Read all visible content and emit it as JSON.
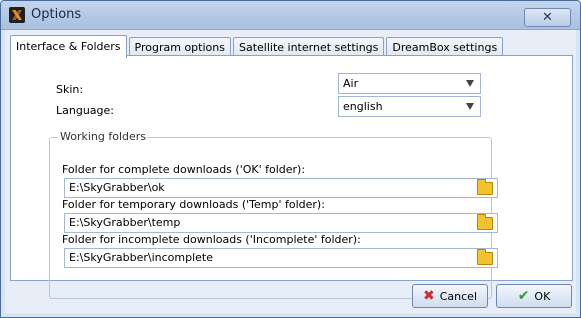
{
  "window": {
    "title": "Options",
    "close_label": "✕"
  },
  "tabs": [
    {
      "label": "Interface & Folders"
    },
    {
      "label": "Program options"
    },
    {
      "label": "Satellite internet settings"
    },
    {
      "label": "DreamBox settings"
    }
  ],
  "interface": {
    "skin_label": "Skin:",
    "skin_value": "Air",
    "language_label": "Language:",
    "language_value": "english"
  },
  "working_folders": {
    "title": "Working folders",
    "ok_label": "Folder for complete downloads ('OK' folder):",
    "ok_value": "E:\\SkyGrabber\\ok",
    "temp_label": "Folder for temporary downloads ('Temp' folder):",
    "temp_value": "E:\\SkyGrabber\\temp",
    "incomplete_label": "Folder for incomplete downloads ('Incomplete' folder):",
    "incomplete_value": "E:\\SkyGrabber\\incomplete"
  },
  "buttons": {
    "cancel": "Cancel",
    "ok": "OK"
  },
  "colors": {
    "cancel_icon": "#d02b2b",
    "ok_icon": "#2f9a2f"
  }
}
